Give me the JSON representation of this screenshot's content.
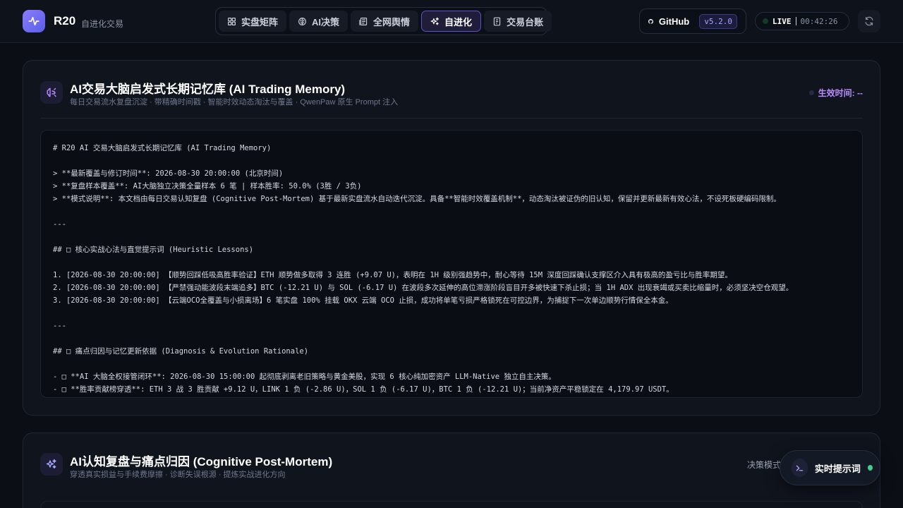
{
  "header": {
    "brand_name": "R20",
    "brand_subtitle": "自进化交易",
    "nav_tabs": [
      {
        "label": "实盘矩阵",
        "icon": "grid-icon"
      },
      {
        "label": "AI决策",
        "icon": "brain-icon"
      },
      {
        "label": "全网舆情",
        "icon": "newspaper-icon"
      },
      {
        "label": "自进化",
        "icon": "sparkles-icon",
        "active": true
      },
      {
        "label": "交易台账",
        "icon": "ledger-icon"
      }
    ],
    "github_label": "GitHub",
    "version": "v5.2.0",
    "live_label": "LIVE",
    "live_time": "00:42:26"
  },
  "memory_card": {
    "title": "AI交易大脑启发式长期记忆库 (AI Trading Memory)",
    "subtitle": "每日交易流水复盘沉淀 · 带精确时间戳 · 智能时效动态淘汰与覆盖 · QwenPaw 原生 Prompt 注入",
    "effective_label": "生效时间: --",
    "lines": [
      "# R20 AI 交易大脑启发式长期记忆库 (AI Trading Memory)",
      "",
      "> **最新覆盖与修订时间**: 2026-08-30 20:00:00 (北京时间)",
      "> **复盘样本覆盖**: AI大脑独立决策全量样本 6 笔 | 样本胜率: 50.0% (3胜 / 3负)",
      "> **模式说明**: 本文档由每日交易认知复盘 (Cognitive Post-Mortem) 基于最新实盘流水自动迭代沉淀。具备**智能时效覆盖机制**，动态淘汰被证伪的旧认知，保留并更新最新有效心法，不设死板硬编码限制。",
      "",
      "---",
      "",
      "## □ 核心实战心法与直觉提示词 (Heuristic Lessons)",
      "",
      "1. [2026-08-30 20:00:00] 【顺势回踩低吸高胜率验证】ETH 顺势做多取得 3 连胜 (+9.07 U)，表明在 1H 级别强趋势中，耐心等待 15M 深度回踩确认支撑区介入具有极高的盈亏比与胜率期望。",
      "2. [2026-08-30 20:00:00] 【严禁强动能波段末端追多】BTC (-12.21 U) 与 SOL (-6.17 U) 在波段多次延伸的高位滞涨阶段盲目开多被快速下杀止损；当 1H ADX 出现衰竭或买卖比缩量时，必须坚决空仓观望。",
      "3. [2026-08-30 20:00:00] 【云端OCO全覆盖与小损离场】6 笔实盘 100% 挂载 OKX 云端 OCO 止损，成功将单笔亏损严格锁死在可控边界，为捕捉下一次单边顺势行情保全本金。",
      "",
      "---",
      "",
      "## □ 痛点归因与记忆更新依据 (Diagnosis & Evolution Rationale)",
      "",
      "- □ **AI 大脑全权接管闭环**: 2026-08-30 15:00:00 起彻底剥离老旧策略与黄金美股，实现 6 核心纯加密资产 LLM-Native 独立自主决策。",
      "- □ **胜率贡献榜穿透**: ETH 3 战 3 胜贡献 +9.12 U，LINK 1 负 (-2.86 U)，SOL 1 负 (-6.17 U)，BTC 1 负 (-12.21 U)；当前净资产平稳锁定在 4,179.97 USDT。"
    ]
  },
  "postmortem_card": {
    "title": "AI认知复盘与痛点归因 (Cognitive Post-Mortem)",
    "subtitle": "穿透真实损益与手续费摩擦 · 诊断失误根源 · 提炼实战进化方向",
    "decision_mode_label": "决策模式"
  },
  "floating": {
    "label": "实时提示词"
  }
}
